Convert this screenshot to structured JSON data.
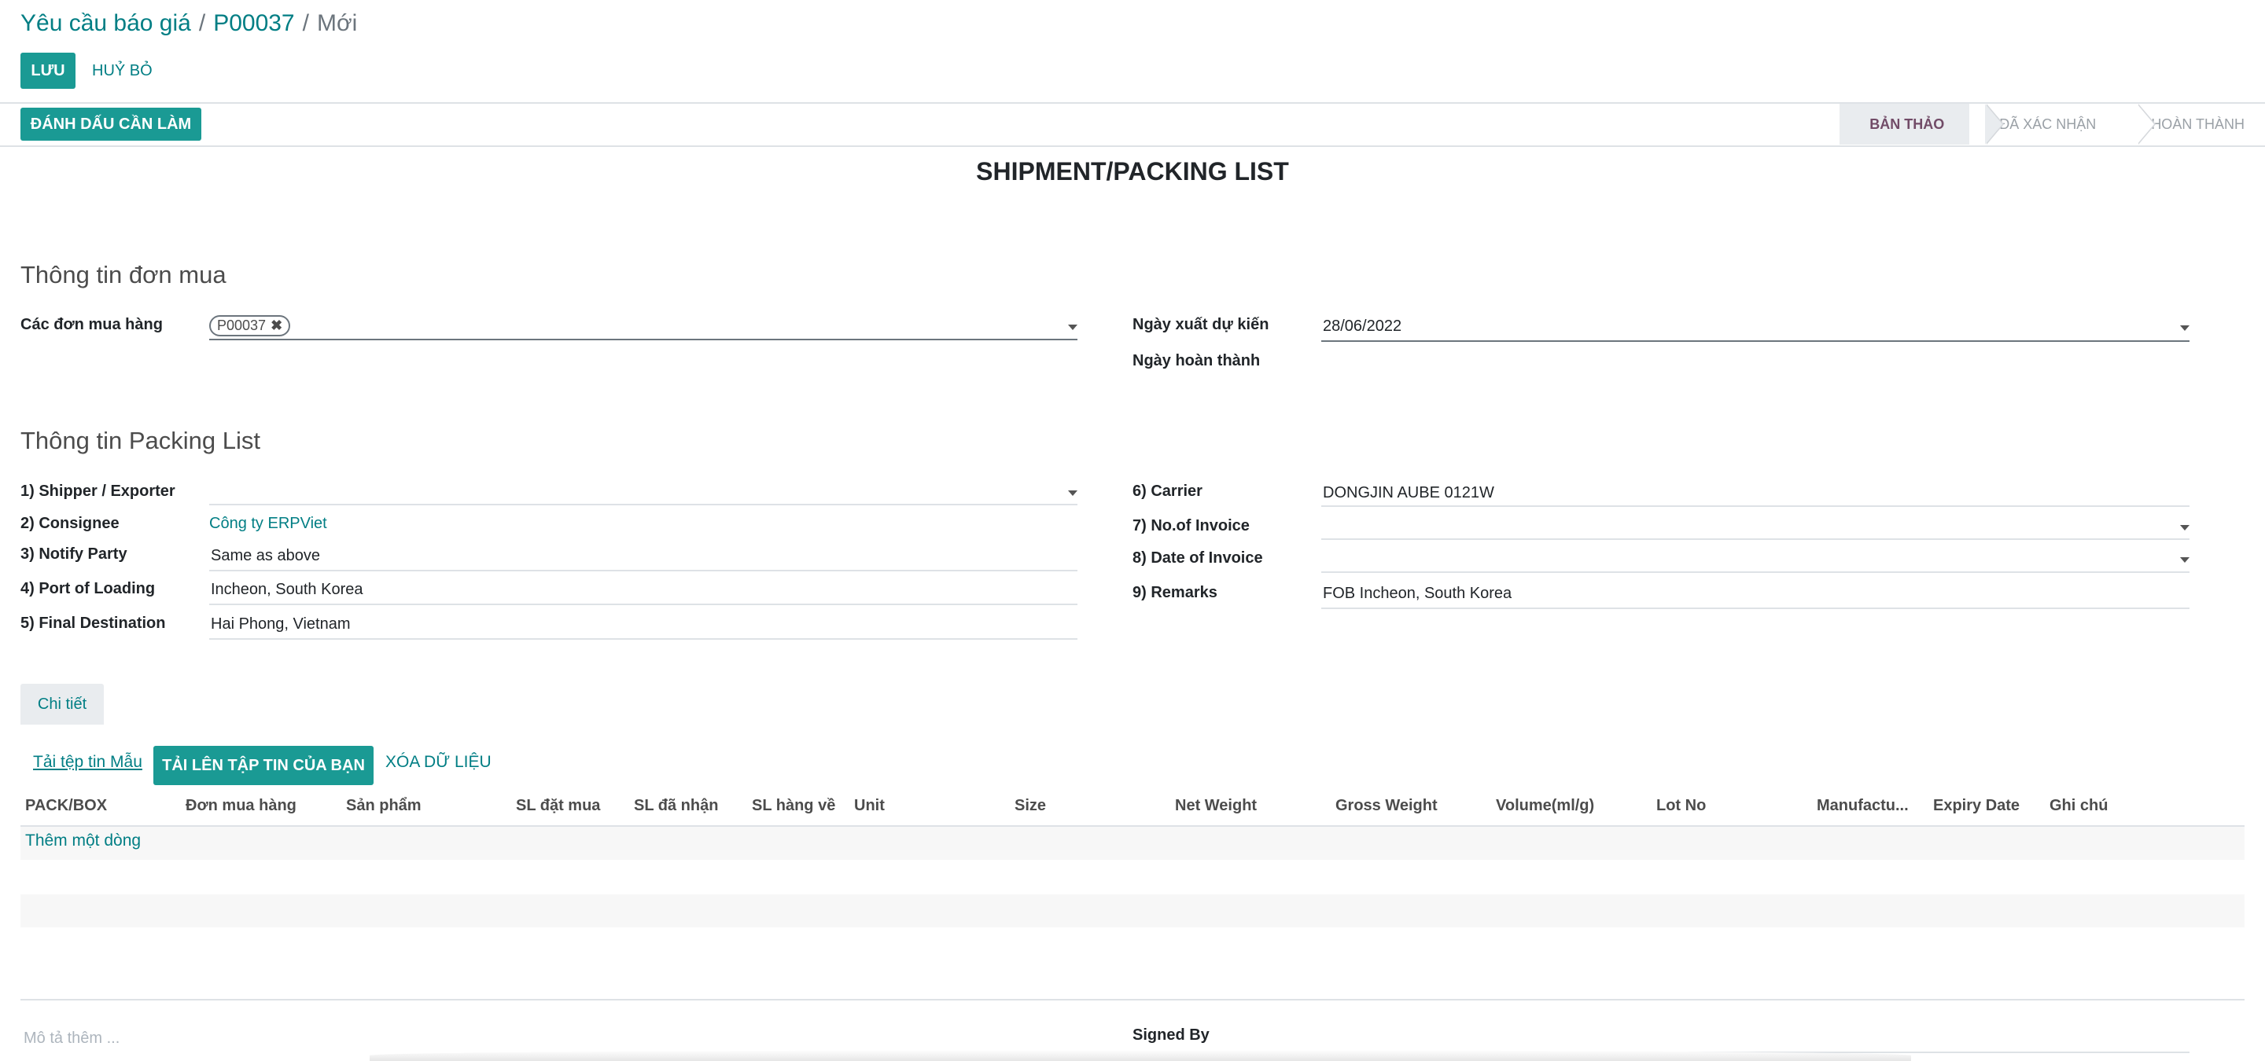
{
  "breadcrumb": {
    "root": "Yêu cầu báo giá",
    "record": "P00037",
    "current": "Mới",
    "separator": "/"
  },
  "actions": {
    "save": "LƯU",
    "discard": "HUỶ BỎ"
  },
  "header": {
    "mark_todo": "ĐÁNH DẤU CẦN LÀM",
    "stages": [
      {
        "label": "BẢN THẢO",
        "active": true
      },
      {
        "label": "ĐÃ XÁC NHẬN",
        "active": false
      },
      {
        "label": "HOÀN THÀNH",
        "active": false
      }
    ]
  },
  "document_title": "SHIPMENT/PACKING LIST",
  "purchase_info": {
    "title": "Thông tin đơn mua",
    "orders_label": "Các đơn mua hàng",
    "orders_tag": "P00037",
    "ship_date_label": "Ngày xuất dự kiến",
    "ship_date_value": "28/06/2022",
    "done_date_label": "Ngày hoàn thành"
  },
  "packing_info": {
    "title": "Thông tin Packing List",
    "left": [
      {
        "label": "1) Shipper / Exporter",
        "value": ""
      },
      {
        "label": "2) Consignee",
        "value": "Công ty ERPViet"
      },
      {
        "label": "3) Notify Party",
        "value": "Same as above"
      },
      {
        "label": "4) Port of Loading",
        "value": "Incheon, South Korea"
      },
      {
        "label": "5) Final Destination",
        "value": "Hai Phong, Vietnam"
      }
    ],
    "right": [
      {
        "label": "6) Carrier",
        "value": "DONGJIN AUBE 0121W"
      },
      {
        "label": "7) No.of Invoice",
        "value": ""
      },
      {
        "label": "8) Date of Invoice",
        "value": ""
      },
      {
        "label": "9) Remarks",
        "value": "FOB Incheon, South Korea"
      }
    ]
  },
  "tabs": {
    "detail": "Chi tiết"
  },
  "lines": {
    "template_link": "Tải tệp tin Mẫu",
    "upload_button": "TẢI LÊN TẬP TIN CỦA BẠN",
    "clear_link": "XÓA DỮ LIỆU",
    "columns": [
      "PACK/BOX",
      "Đơn mua hàng",
      "Sản phẩm",
      "SL đặt mua",
      "SL đã nhận",
      "SL hàng về",
      "Unit",
      "Size",
      "Net Weight",
      "Gross Weight",
      "Volume(ml/g)",
      "Lot No",
      "Manufactu...",
      "Expiry Date",
      "Ghi chú"
    ],
    "add_line": "Thêm một dòng"
  },
  "footer": {
    "note_placeholder": "Mô tả thêm ...",
    "signed_by_label": "Signed By"
  },
  "colors": {
    "accent": "#1a9a94",
    "link": "#017e84",
    "stage_active": "#714b67"
  }
}
